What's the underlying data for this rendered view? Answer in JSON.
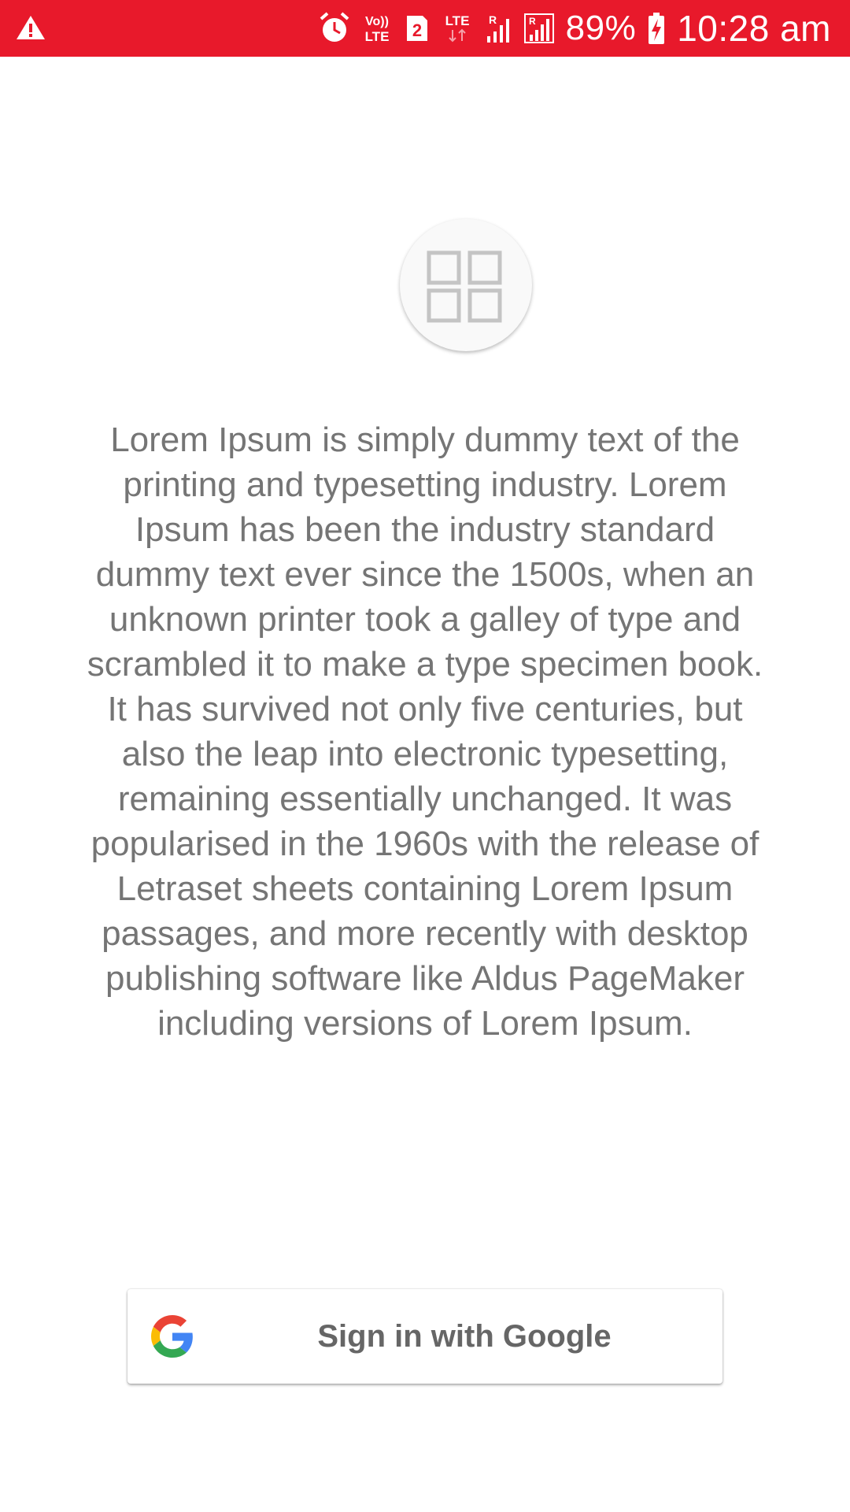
{
  "status_bar": {
    "color": "#e8192b",
    "volte_top": "Vo))",
    "volte_bottom": "LTE",
    "sim_badge": "2",
    "lte_label": "LTE",
    "roaming_label": "R",
    "battery_percent": "89%",
    "time": "10:28 am",
    "icons": [
      "warning-icon",
      "alarm-icon",
      "volte-icon",
      "sim-2-icon",
      "lte-data-icon",
      "signal-roaming-icon",
      "signal-icon",
      "battery-charging-icon"
    ]
  },
  "app_icon": {
    "name": "grid-icon",
    "color": "#c4c4c4"
  },
  "description": "Lorem Ipsum is simply dummy text of the printing and typesetting industry. Lorem Ipsum has been the industry standard dummy text ever since the 1500s, when an unknown printer took a galley of type and scrambled it to make a type specimen book. It has survived not only five centuries, but also the leap into electronic typesetting, remaining essentially unchanged. It was popularised in the 1960s with the release of Letraset sheets containing Lorem Ipsum passages, and more recently with desktop publishing software like Aldus PageMaker including versions of Lorem Ipsum.",
  "sign_in": {
    "label": "Sign in with Google",
    "icon": "google-logo-icon"
  }
}
